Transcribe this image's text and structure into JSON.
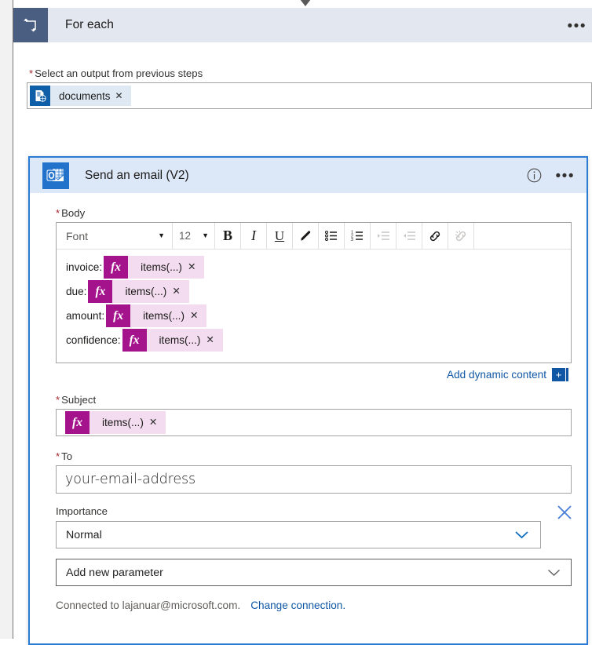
{
  "colors": {
    "foreach_header_bg": "#e3e7ef",
    "foreach_icon_bg": "#4a5e81",
    "email_header_bg": "#dce8f7",
    "email_icon_bg": "#2272cc",
    "card_border": "#2a7bd4",
    "token_fx_badge": "#a4138c",
    "token_fx_bg": "#f3dcef",
    "doc_token_bg": "#dfe9f4",
    "link_blue": "#0f57a5",
    "required_star": "#a4262c"
  },
  "foreach": {
    "icon": "loop-icon",
    "title": "For each",
    "overflow_label": "•••",
    "select_output": {
      "required": "*",
      "label": "Select an output from previous steps",
      "token": {
        "icon": "document-list-icon",
        "text": "documents",
        "remove_label": "✕"
      }
    }
  },
  "email_card": {
    "icon": "outlook-icon",
    "title": "Send an email (V2)",
    "info_label": "i",
    "overflow_label": "•••",
    "body": {
      "required": "*",
      "label": "Body",
      "toolbar": {
        "font_placeholder": "Font",
        "font_caret": "▼",
        "size_placeholder": "12",
        "size_caret": "▼",
        "bold": "B",
        "italic": "I",
        "underline": "U",
        "highlight_icon": "highlighter-icon",
        "bulleted_list_icon": "bulleted-list-icon",
        "numbered_list_icon": "numbered-list-icon",
        "indent_icon": "indent-icon",
        "outdent_icon": "outdent-icon",
        "link_icon": "link-icon",
        "unlink_icon": "unlink-icon"
      },
      "lines": [
        {
          "label": "invoice:",
          "token_badge": "fx",
          "token_text": "items(...)",
          "remove_label": "✕"
        },
        {
          "label": "due:",
          "token_badge": "fx",
          "token_text": "items(...)",
          "remove_label": "✕"
        },
        {
          "label": "amount:",
          "token_badge": "fx",
          "token_text": "items(...)",
          "remove_label": "✕"
        },
        {
          "label": "confidence:",
          "token_badge": "fx",
          "token_text": "items(...)",
          "remove_label": "✕"
        }
      ]
    },
    "add_dynamic_content": {
      "label": "Add dynamic content",
      "plus_label": "+"
    },
    "subject": {
      "required": "*",
      "label": "Subject",
      "token": {
        "badge": "fx",
        "text": "items(...)",
        "remove_label": "✕"
      }
    },
    "to": {
      "required": "*",
      "label": "To",
      "value": "your-email-address"
    },
    "importance": {
      "label": "Importance",
      "value": "Normal",
      "caret": "∨",
      "delete_label": "✕"
    },
    "add_new_parameter": {
      "label": "Add new parameter",
      "caret": "∨"
    },
    "connection": {
      "text": "Connected to lajanuar@microsoft.com.",
      "link": "Change connection."
    }
  }
}
